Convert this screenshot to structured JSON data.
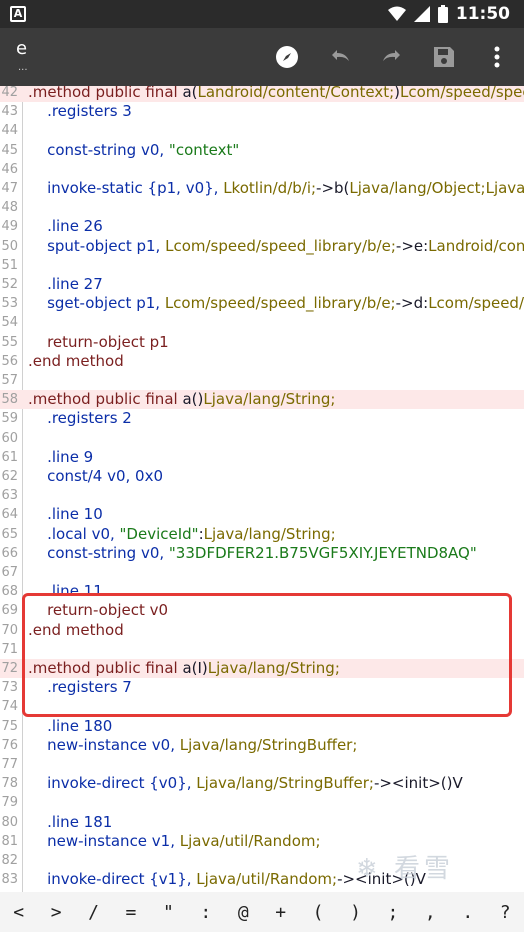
{
  "status": {
    "time": "11:50",
    "a_label": "A"
  },
  "appbar": {
    "title": "e",
    "subtitle": "..."
  },
  "watermark": "❄ 看雪",
  "lines": [
    {
      "n": "42",
      "hl": true,
      "t": [
        [
          "kw",
          ".method public final "
        ],
        [
          "plain",
          "a("
        ],
        [
          "type",
          "Landroid/content/Context;"
        ],
        [
          "plain",
          ")"
        ],
        [
          "type",
          "Lcom/speed/spee"
        ]
      ]
    },
    {
      "n": "43",
      "t": [
        [
          "plain",
          "    "
        ],
        [
          "dir",
          ".registers 3"
        ]
      ]
    },
    {
      "n": "44",
      "t": []
    },
    {
      "n": "45",
      "t": [
        [
          "plain",
          "    "
        ],
        [
          "dir",
          "const-string "
        ],
        [
          "dir",
          "v0, "
        ],
        [
          "str",
          "\"context\""
        ]
      ]
    },
    {
      "n": "46",
      "t": []
    },
    {
      "n": "47",
      "t": [
        [
          "plain",
          "    "
        ],
        [
          "dir",
          "invoke-static {p1, v0}, "
        ],
        [
          "type",
          "Lkotlin/d/b/i;"
        ],
        [
          "plain",
          "->b("
        ],
        [
          "type",
          "Ljava/lang/Object;Ljava/la"
        ]
      ]
    },
    {
      "n": "48",
      "t": []
    },
    {
      "n": "49",
      "t": [
        [
          "plain",
          "    "
        ],
        [
          "dir",
          ".line 26"
        ]
      ]
    },
    {
      "n": "50",
      "t": [
        [
          "plain",
          "    "
        ],
        [
          "dir",
          "sput-object p1, "
        ],
        [
          "type",
          "Lcom/speed/speed_library/b/e;"
        ],
        [
          "plain",
          "->e:"
        ],
        [
          "type",
          "Landroid/cont"
        ]
      ]
    },
    {
      "n": "51",
      "t": []
    },
    {
      "n": "52",
      "t": [
        [
          "plain",
          "    "
        ],
        [
          "dir",
          ".line 27"
        ]
      ]
    },
    {
      "n": "53",
      "t": [
        [
          "plain",
          "    "
        ],
        [
          "dir",
          "sget-object p1, "
        ],
        [
          "type",
          "Lcom/speed/speed_library/b/e;"
        ],
        [
          "plain",
          "->d:"
        ],
        [
          "type",
          "Lcom/speed/s"
        ]
      ]
    },
    {
      "n": "54",
      "t": []
    },
    {
      "n": "55",
      "t": [
        [
          "plain",
          "    "
        ],
        [
          "kw",
          "return-object p1"
        ]
      ]
    },
    {
      "n": "56",
      "t": [
        [
          "kw",
          ".end method"
        ]
      ]
    },
    {
      "n": "57",
      "t": []
    },
    {
      "n": "58",
      "hl": true,
      "t": [
        [
          "kw",
          ".method public final "
        ],
        [
          "plain",
          "a()"
        ],
        [
          "type",
          "Ljava/lang/String;"
        ]
      ]
    },
    {
      "n": "59",
      "t": [
        [
          "plain",
          "    "
        ],
        [
          "dir",
          ".registers 2"
        ]
      ]
    },
    {
      "n": "60",
      "t": []
    },
    {
      "n": "61",
      "t": [
        [
          "plain",
          "    "
        ],
        [
          "dir",
          ".line 9"
        ]
      ]
    },
    {
      "n": "62",
      "t": [
        [
          "plain",
          "    "
        ],
        [
          "dir",
          "const/4 v0, 0x0"
        ]
      ]
    },
    {
      "n": "63",
      "t": []
    },
    {
      "n": "64",
      "t": [
        [
          "plain",
          "    "
        ],
        [
          "dir",
          ".line 10"
        ]
      ]
    },
    {
      "n": "65",
      "t": [
        [
          "plain",
          "    "
        ],
        [
          "dir",
          ".local v0, "
        ],
        [
          "str",
          "\"DeviceId\""
        ],
        [
          "plain",
          ":"
        ],
        [
          "type",
          "Ljava/lang/String;"
        ]
      ]
    },
    {
      "n": "66",
      "t": [
        [
          "plain",
          "    "
        ],
        [
          "dir",
          "const-string v0, "
        ],
        [
          "str",
          "\"33DFDFER21.B75VGF5XIY.JEYETND8AQ\""
        ]
      ]
    },
    {
      "n": "67",
      "t": []
    },
    {
      "n": "68",
      "t": [
        [
          "plain",
          "    "
        ],
        [
          "dir",
          ".line 11"
        ]
      ]
    },
    {
      "n": "69",
      "t": [
        [
          "plain",
          "    "
        ],
        [
          "kw",
          "return-object v0"
        ]
      ]
    },
    {
      "n": "70",
      "t": [
        [
          "kw",
          ".end method"
        ]
      ]
    },
    {
      "n": "71",
      "t": []
    },
    {
      "n": "72",
      "hl": true,
      "t": [
        [
          "kw",
          ".method public final "
        ],
        [
          "plain",
          "a(I)"
        ],
        [
          "type",
          "Ljava/lang/String;"
        ]
      ]
    },
    {
      "n": "73",
      "t": [
        [
          "plain",
          "    "
        ],
        [
          "dir",
          ".registers 7"
        ]
      ]
    },
    {
      "n": "74",
      "t": []
    },
    {
      "n": "75",
      "t": [
        [
          "plain",
          "    "
        ],
        [
          "dir",
          ".line 180"
        ]
      ]
    },
    {
      "n": "76",
      "t": [
        [
          "plain",
          "    "
        ],
        [
          "dir",
          "new-instance v0, "
        ],
        [
          "type",
          "Ljava/lang/StringBuffer;"
        ]
      ]
    },
    {
      "n": "77",
      "t": []
    },
    {
      "n": "78",
      "t": [
        [
          "plain",
          "    "
        ],
        [
          "dir",
          "invoke-direct {v0}, "
        ],
        [
          "type",
          "Ljava/lang/StringBuffer;"
        ],
        [
          "plain",
          "-><init>()V"
        ]
      ]
    },
    {
      "n": "79",
      "t": []
    },
    {
      "n": "80",
      "t": [
        [
          "plain",
          "    "
        ],
        [
          "dir",
          ".line 181"
        ]
      ]
    },
    {
      "n": "81",
      "t": [
        [
          "plain",
          "    "
        ],
        [
          "dir",
          "new-instance v1, "
        ],
        [
          "type",
          "Ljava/util/Random;"
        ]
      ]
    },
    {
      "n": "82",
      "t": []
    },
    {
      "n": "83",
      "t": [
        [
          "plain",
          "    "
        ],
        [
          "dir",
          "invoke-direct {v1}, "
        ],
        [
          "type",
          "Ljava/util/Random;"
        ],
        [
          "plain",
          "-><init>()V"
        ]
      ]
    }
  ],
  "keys": [
    "<",
    ">",
    "/",
    "=",
    "\"",
    ":",
    "@",
    "+",
    "(",
    ")",
    ";",
    ",",
    ".",
    "?"
  ],
  "icons": [
    "compass-icon",
    "undo-icon",
    "redo-icon",
    "save-icon",
    "more-vert-icon"
  ]
}
